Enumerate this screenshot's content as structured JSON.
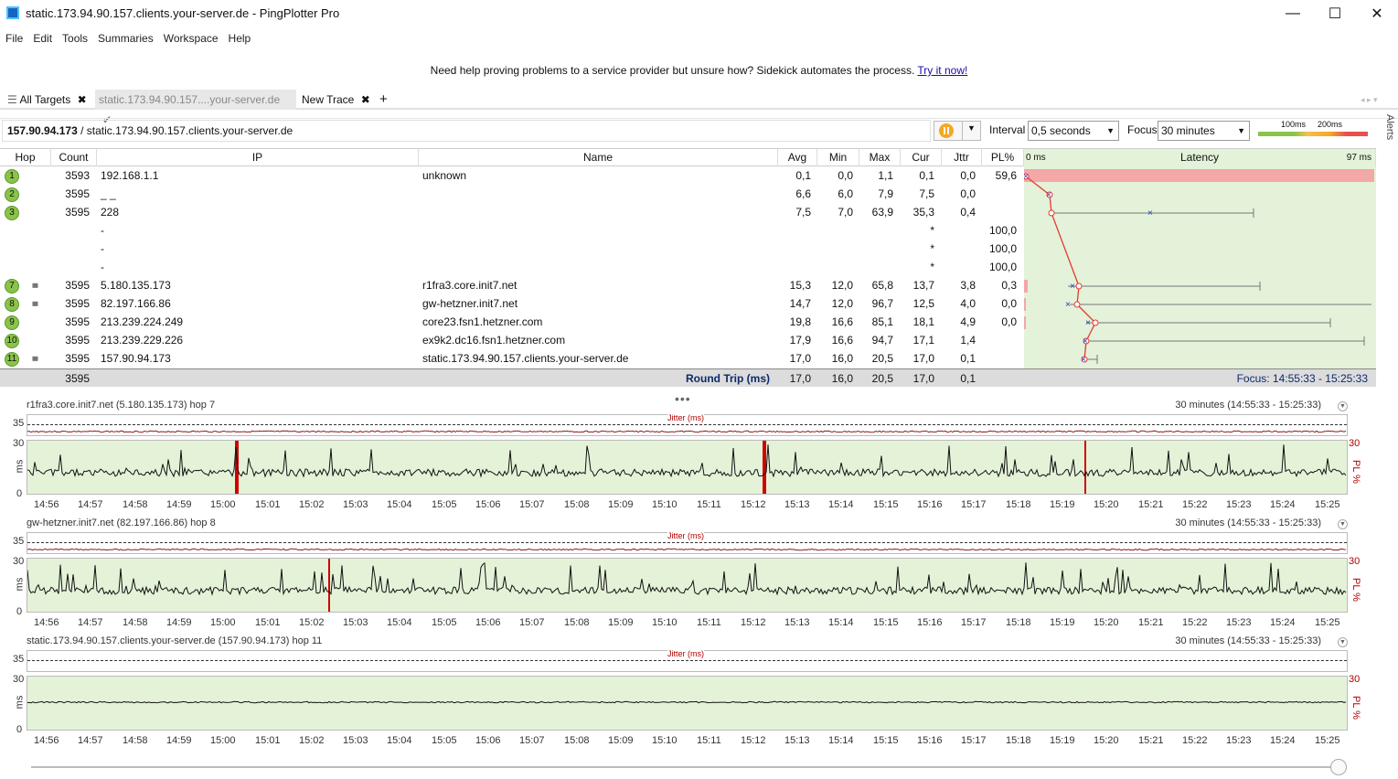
{
  "window": {
    "title": "static.173.94.90.157.clients.your-server.de - PingPlotter Pro",
    "min": "—",
    "max": "☐",
    "close": "✕"
  },
  "menu": [
    "File",
    "Edit",
    "Tools",
    "Summaries",
    "Workspace",
    "Help"
  ],
  "promo": {
    "text": "Need help proving problems to a service provider but unsure how? Sidekick automates the process.",
    "link": "Try it now!"
  },
  "tabs": [
    {
      "label": "All Targets",
      "icon": "✖"
    },
    {
      "label": "static.173.94.90.157....your-server.de",
      "icon": "✔"
    },
    {
      "label": "New Trace",
      "icon": "✖"
    }
  ],
  "tab_add": "+",
  "target": {
    "ip": "157.90.94.173",
    "sep": " / ",
    "host": "static.173.94.90.157.clients.your-server.de"
  },
  "controls": {
    "interval_label": "Interval",
    "interval_value": "0,5 seconds",
    "focus_label": "Focus",
    "focus_value": "30 minutes",
    "scale_100": "100ms",
    "scale_200": "200ms",
    "alerts": "Alerts"
  },
  "columns": {
    "hop": "Hop",
    "count": "Count",
    "ip": "IP",
    "name": "Name",
    "avg": "Avg",
    "min": "Min",
    "max": "Max",
    "cur": "Cur",
    "jttr": "Jttr",
    "pl": "PL%",
    "latency": "Latency",
    "lat_min": "0 ms",
    "lat_max": "97 ms"
  },
  "rows": [
    {
      "hop": "1",
      "count": "3593",
      "ip": "192.168.1.1",
      "name": "unknown",
      "avg": "0,1",
      "min": "0,0",
      "max": "1,1",
      "cur": "0,1",
      "jttr": "0,0",
      "pl": "59,6"
    },
    {
      "hop": "2",
      "count": "3595",
      "ip": "_            _",
      "name": "",
      "avg": "6,6",
      "min": "6,0",
      "max": "7,9",
      "cur": "7,5",
      "jttr": "0,0",
      "pl": ""
    },
    {
      "hop": "3",
      "count": "3595",
      "ip": "228",
      "name": "",
      "avg": "7,5",
      "min": "7,0",
      "max": "63,9",
      "cur": "35,3",
      "jttr": "0,4",
      "pl": ""
    },
    {
      "hop": "",
      "count": "",
      "ip": "-",
      "name": "",
      "avg": "",
      "min": "",
      "max": "",
      "cur": "*",
      "jttr": "",
      "pl": "100,0"
    },
    {
      "hop": "",
      "count": "",
      "ip": "-",
      "name": "",
      "avg": "",
      "min": "",
      "max": "",
      "cur": "*",
      "jttr": "",
      "pl": "100,0"
    },
    {
      "hop": "",
      "count": "",
      "ip": "-",
      "name": "",
      "avg": "",
      "min": "",
      "max": "",
      "cur": "*",
      "jttr": "",
      "pl": "100,0"
    },
    {
      "hop": "7",
      "count": "3595",
      "ip": "5.180.135.173",
      "name": "r1fra3.core.init7.net",
      "avg": "15,3",
      "min": "12,0",
      "max": "65,8",
      "cur": "13,7",
      "jttr": "3,8",
      "pl": "0,3"
    },
    {
      "hop": "8",
      "count": "3595",
      "ip": "82.197.166.86",
      "name": "gw-hetzner.init7.net",
      "avg": "14,7",
      "min": "12,0",
      "max": "96,7",
      "cur": "12,5",
      "jttr": "4,0",
      "pl": "0,0"
    },
    {
      "hop": "9",
      "count": "3595",
      "ip": "213.239.224.249",
      "name": "core23.fsn1.hetzner.com",
      "avg": "19,8",
      "min": "16,6",
      "max": "85,1",
      "cur": "18,1",
      "jttr": "4,9",
      "pl": "0,0"
    },
    {
      "hop": "10",
      "count": "3595",
      "ip": "213.239.229.226",
      "name": "ex9k2.dc16.fsn1.hetzner.com",
      "avg": "17,9",
      "min": "16,6",
      "max": "94,7",
      "cur": "17,1",
      "jttr": "1,4",
      "pl": ""
    },
    {
      "hop": "11",
      "count": "3595",
      "ip": "157.90.94.173",
      "name": "static.173.94.90.157.clients.your-server.de",
      "avg": "17,0",
      "min": "16,0",
      "max": "20,5",
      "cur": "17,0",
      "jttr": "0,1",
      "pl": ""
    }
  ],
  "summary": {
    "count": "3595",
    "label": "Round Trip (ms)",
    "avg": "17,0",
    "min": "16,0",
    "max": "20,5",
    "cur": "17,0",
    "jttr": "0,1",
    "focus": "Focus: 14:55:33 - 15:25:33"
  },
  "time_ticks": [
    "14:56",
    "14:57",
    "14:58",
    "14:59",
    "15:00",
    "15:01",
    "15:02",
    "15:03",
    "15:04",
    "15:05",
    "15:06",
    "15:07",
    "15:08",
    "15:09",
    "15:10",
    "15:11",
    "15:12",
    "15:13",
    "15:14",
    "15:15",
    "15:16",
    "15:17",
    "15:18",
    "15:19",
    "15:20",
    "15:21",
    "15:22",
    "15:23",
    "15:24",
    "15:25"
  ],
  "graphs": [
    {
      "title": "r1fra3.core.init7.net (5.180.135.173) hop 7",
      "range": "30 minutes (14:55:33 - 15:25:33)",
      "jitter": "Jitter (ms)",
      "y_jit": "35",
      "y_top": "30",
      "y_unit": "ms",
      "y_bot": "0",
      "pl_top": "30",
      "pl_unit": "PL %"
    },
    {
      "title": "gw-hetzner.init7.net (82.197.166.86) hop 8",
      "range": "30 minutes (14:55:33 - 15:25:33)",
      "jitter": "Jitter (ms)",
      "y_jit": "35",
      "y_top": "30",
      "y_unit": "ms",
      "y_bot": "0",
      "pl_top": "30",
      "pl_unit": "PL %"
    },
    {
      "title": "static.173.94.90.157.clients.your-server.de (157.90.94.173) hop 11",
      "range": "30 minutes (14:55:33 - 15:25:33)",
      "jitter": "Jitter (ms)",
      "y_jit": "35",
      "y_top": "30",
      "y_unit": "ms",
      "y_bot": "0",
      "pl_top": "30",
      "pl_unit": "PL %"
    }
  ],
  "colors": {
    "accent": "#f5a623",
    "good": "#8bc34a",
    "loss": "#f4a7a7",
    "latency_bg": "#e3f2d9"
  }
}
